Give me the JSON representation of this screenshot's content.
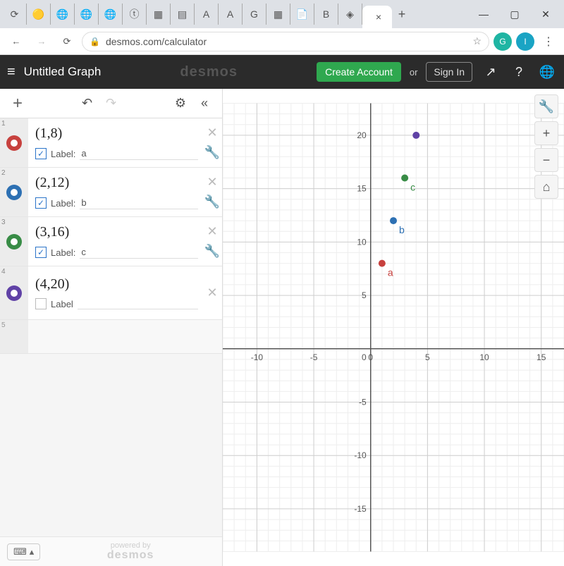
{
  "browser": {
    "tabs_favicons": [
      "⟳",
      "🟡",
      "🌐",
      "🌐",
      "🌐",
      "ⓣ",
      "▦",
      "▤",
      "A",
      "A",
      "G",
      "▦",
      "📄",
      "B",
      "◈"
    ],
    "active_tab_close": "×",
    "newtab": "+",
    "win_min": "—",
    "win_max": "▢",
    "win_close": "✕"
  },
  "addr": {
    "back": "←",
    "forward": "→",
    "reload": "⟳",
    "lock": "🔒",
    "url": "desmos.com/calculator",
    "star": "☆",
    "ext_g": "G",
    "ext_a": "I",
    "kebab": "⋮"
  },
  "header": {
    "hamburger": "≡",
    "title": "Untitled Graph",
    "brand": "desmos",
    "create": "Create Account",
    "or": "or",
    "signin": "Sign In",
    "share": "↗",
    "help": "?",
    "lang": "🌐"
  },
  "sidetb": {
    "add": "+",
    "undo": "↶",
    "redo": "↷",
    "settings": "⚙",
    "collapse": "«"
  },
  "exprs": [
    {
      "idx": "1",
      "color": "#c7413e",
      "formula": "(1,8)",
      "checked": true,
      "label_word": "Label:",
      "label": "a"
    },
    {
      "idx": "2",
      "color": "#2d70b3",
      "formula": "(2,12)",
      "checked": true,
      "label_word": "Label:",
      "label": "b"
    },
    {
      "idx": "3",
      "color": "#388c46",
      "formula": "(3,16)",
      "checked": true,
      "label_word": "Label:",
      "label": "c"
    },
    {
      "idx": "4",
      "color": "#6042a6",
      "formula": "(4,20)",
      "checked": false,
      "label_word": "Label",
      "label": ""
    }
  ],
  "empty_idx": "5",
  "footer": {
    "kbd": "⌨",
    "kbd_caret": "▴",
    "powered_top": "powered by",
    "powered_brand": "desmos"
  },
  "graph_tools": {
    "wrench": "🔧",
    "plus": "+",
    "minus": "−",
    "home": "⌂"
  },
  "chart_data": {
    "type": "scatter",
    "title": "",
    "xlabel": "",
    "ylabel": "",
    "xlim": [
      -13,
      17
    ],
    "ylim": [
      -19,
      23
    ],
    "xticks": [
      -10,
      -5,
      0,
      5,
      10,
      15
    ],
    "yticks": [
      -15,
      -10,
      -5,
      5,
      10,
      15,
      20
    ],
    "grid": true,
    "series": [
      {
        "name": "a",
        "color": "#c7413e",
        "points": [
          [
            1,
            8
          ]
        ],
        "label": "a"
      },
      {
        "name": "b",
        "color": "#2d70b3",
        "points": [
          [
            2,
            12
          ]
        ],
        "label": "b"
      },
      {
        "name": "c",
        "color": "#388c46",
        "points": [
          [
            3,
            16
          ]
        ],
        "label": "c"
      },
      {
        "name": "",
        "color": "#6042a6",
        "points": [
          [
            4,
            20
          ]
        ],
        "label": ""
      }
    ]
  }
}
